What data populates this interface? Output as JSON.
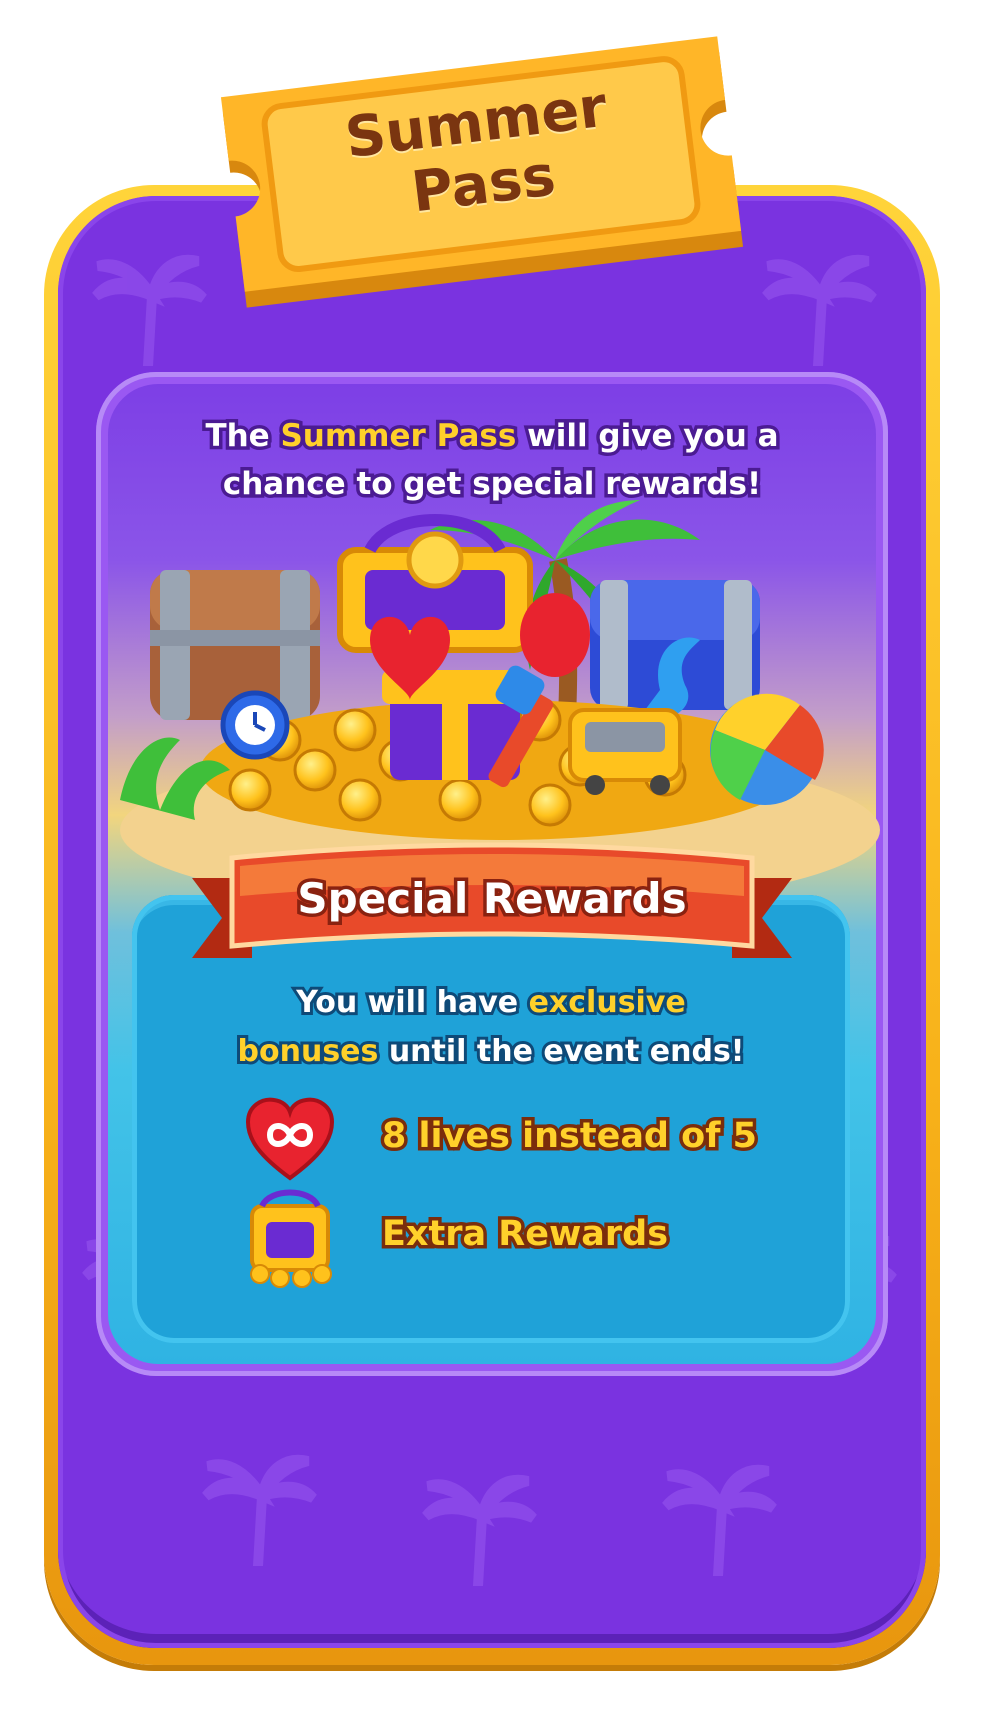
{
  "header": {
    "title_line1": "Summer",
    "title_line2": "Pass"
  },
  "intro": {
    "part1": "The ",
    "highlight": "Summer Pass",
    "part2": " will give you a",
    "line2": "chance to get special rewards!"
  },
  "banner": {
    "label": "Special Rewards"
  },
  "bonus": {
    "part1": "You will have ",
    "highlight1": "exclusive",
    "highlight2": "bonuses",
    "part2": " until the event ends!"
  },
  "benefits": [
    {
      "icon": "infinity-heart-icon",
      "label": "8 lives instead of 5"
    },
    {
      "icon": "treasure-chest-icon",
      "label": "Extra Rewards"
    }
  ],
  "colors": {
    "frame_gold": "#f8b21a",
    "panel_purple": "#7a33e0",
    "highlight_yellow": "#ffd02a",
    "rewards_blue": "#1fa2d8",
    "banner_red": "#e84a2a"
  }
}
